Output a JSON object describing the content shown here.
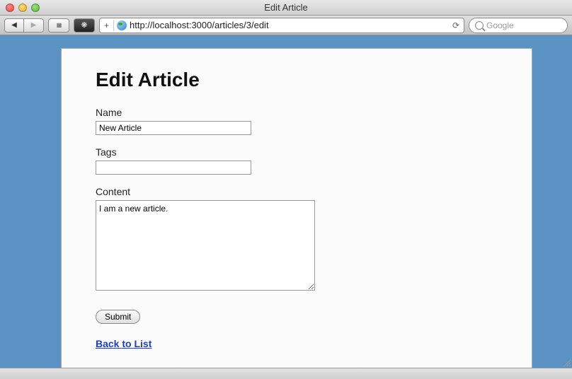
{
  "window": {
    "title": "Edit Article"
  },
  "addressbar": {
    "url": "http://localhost:3000/articles/3/edit"
  },
  "search": {
    "placeholder": "Google"
  },
  "page": {
    "heading": "Edit Article",
    "form": {
      "name": {
        "label": "Name",
        "value": "New Article"
      },
      "tags": {
        "label": "Tags",
        "value": ""
      },
      "content": {
        "label": "Content",
        "value": "I am a new article."
      },
      "submit_label": "Submit"
    },
    "back_link": "Back to List"
  }
}
